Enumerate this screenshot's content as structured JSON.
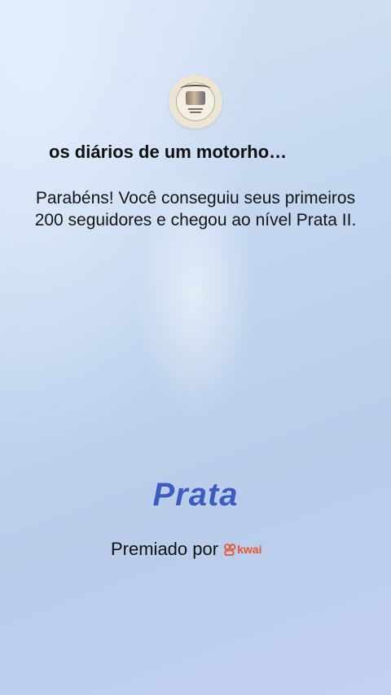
{
  "profile": {
    "name": "os diários de um motorho…"
  },
  "message": "Parabéns! Você conseguiu seus primeiros 200 seguidores e chegou ao nível Prata II.",
  "level": "Prata",
  "footer": {
    "awarded_by": "Premiado por",
    "brand": "kwai",
    "brand_color": "#e8562a"
  },
  "colors": {
    "level_text": "#3c5cc4"
  }
}
